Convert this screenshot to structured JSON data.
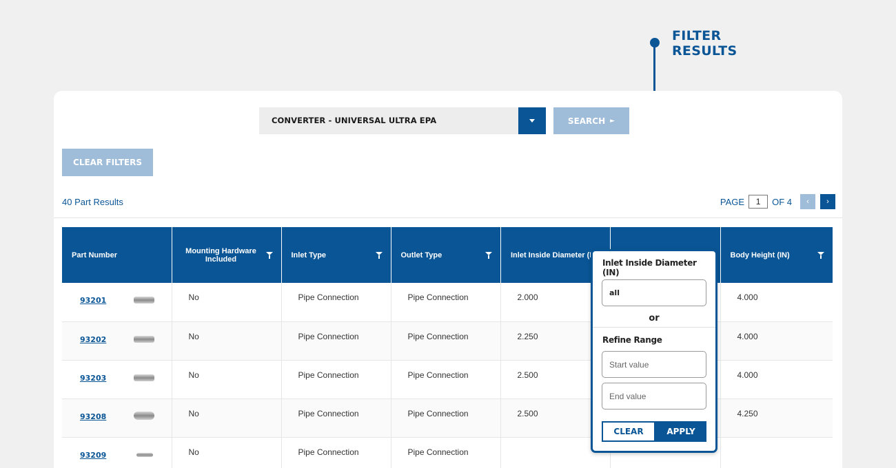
{
  "callout": {
    "line1": "FILTER",
    "line2": "RESULTS"
  },
  "search": {
    "selected": "CONVERTER - UNIVERSAL ULTRA EPA",
    "search_label": "SEARCH",
    "search_arrow": "►"
  },
  "clear_filters": "CLEAR FILTERS",
  "results_count": "40 Part Results",
  "pager": {
    "page_label": "PAGE",
    "current": "1",
    "of_label": "OF 4",
    "prev": "‹",
    "next": "›"
  },
  "columns": [
    "Part Number",
    "Mounting Hardware Included",
    "Inlet Type",
    "Outlet Type",
    "Inlet Inside Diameter (IN)",
    "",
    "Body Height (IN)"
  ],
  "rows": [
    {
      "part": "93201",
      "mounting": "No",
      "inlet": "Pipe Connection",
      "outlet": "Pipe Connection",
      "inlet_dia": "2.000",
      "col6": "",
      "height": "4.000"
    },
    {
      "part": "93202",
      "mounting": "No",
      "inlet": "Pipe Connection",
      "outlet": "Pipe Connection",
      "inlet_dia": "2.250",
      "col6": "",
      "height": "4.000"
    },
    {
      "part": "93203",
      "mounting": "No",
      "inlet": "Pipe Connection",
      "outlet": "Pipe Connection",
      "inlet_dia": "2.500",
      "col6": "",
      "height": "4.000"
    },
    {
      "part": "93208",
      "mounting": "No",
      "inlet": "Pipe Connection",
      "outlet": "Pipe Connection",
      "inlet_dia": "2.500",
      "col6": "",
      "height": "4.250"
    },
    {
      "part": "93209",
      "mounting": "No",
      "inlet": "Pipe Connection",
      "outlet": "Pipe Connection",
      "inlet_dia": "",
      "col6": "",
      "height": ""
    }
  ],
  "filter_popup": {
    "title": "Inlet Inside Diameter (IN)",
    "value": "all",
    "or_label": "or",
    "refine_label": "Refine Range",
    "start_placeholder": "Start value",
    "end_placeholder": "End value",
    "clear_label": "CLEAR",
    "apply_label": "APPLY"
  },
  "colors": {
    "brand": "#0a5596",
    "disabled": "#9fbcd8",
    "background": "#f0f0f0"
  }
}
